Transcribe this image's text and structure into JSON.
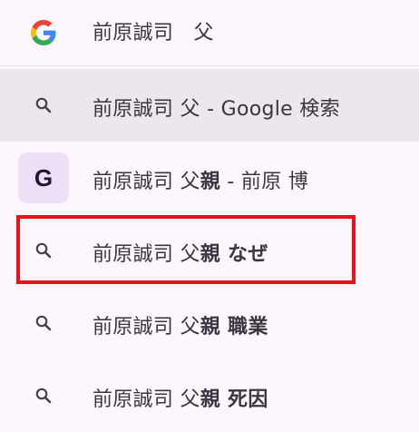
{
  "input": {
    "text": "前原誠司　父",
    "icon": "google-g-icon"
  },
  "suggestions": [
    {
      "icon": "search-icon",
      "main": "前原誠司 父 - Google 検索",
      "bold": "",
      "tail": ""
    },
    {
      "icon": "google-tile-icon",
      "main": "前原誠司 父",
      "bold": "親",
      "tail": " - 前原 博"
    },
    {
      "icon": "search-icon",
      "main": "前原誠司 父",
      "bold": "親 なぜ",
      "tail": ""
    },
    {
      "icon": "search-icon",
      "main": "前原誠司 父",
      "bold": "親 職業",
      "tail": ""
    },
    {
      "icon": "search-icon",
      "main": "前原誠司 父",
      "bold": "親 死因",
      "tail": ""
    }
  ],
  "colors": {
    "highlight": "#e5141b",
    "hover": "#ece6ed",
    "tile": "#ecdff6"
  }
}
